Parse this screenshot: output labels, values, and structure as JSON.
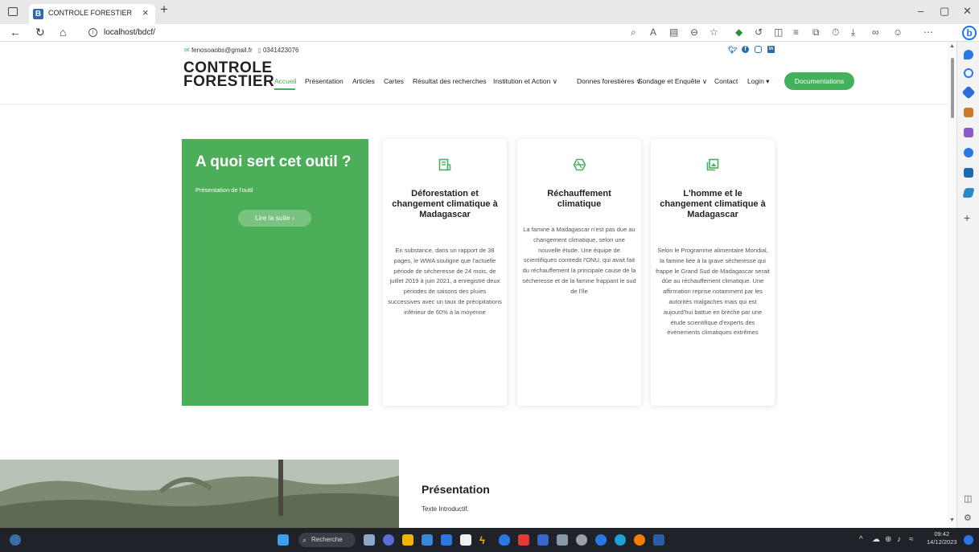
{
  "browser": {
    "tab_title": "CONTROLE FORESTIER",
    "tab_favicon": "B",
    "url": "localhost/bdcf/",
    "window_controls": [
      "–",
      "▢",
      "✕"
    ],
    "new_tab": "+",
    "tab_close": "×"
  },
  "topbar": {
    "email": "fenosoaobs@gmail.fr",
    "phone": "0341423076",
    "social_icons": [
      "twitter-icon",
      "facebook-icon",
      "instagram-icon",
      "linkedin-icon"
    ]
  },
  "header": {
    "logo_line1": "CONTROLE",
    "logo_line2": "FORESTIER",
    "nav": {
      "accueil": "Accueil",
      "presentation": "Présentation",
      "articles": "Articles",
      "cartes": "Cartes",
      "resultat": "Résultat des recherches",
      "institution": "Institution et Action ∨",
      "donnees": "Donnes forestières ∨",
      "sondage": "Sondage et Enquête ∨",
      "contact": "Contact",
      "login": "Login ▾"
    },
    "doc_button": "Documentations"
  },
  "hero": {
    "title": "A quoi sert cet outil ?",
    "subtitle": "Présentation de l'outil",
    "button": "Lire la suite  ›"
  },
  "cards": [
    {
      "icon": "document-chart-icon",
      "title": "Déforestation et changement climatique à Madagascar",
      "text": "En substance, dans un rapport de 38 pages, le WWA souligne que l'actuelle période de sécheresse de 24 mois, de juillet 2019 à juin 2021, a enregistré deux périodes de saisons des pluies successives avec un taux de précipitations inférieur de 60% à la moyenne"
    },
    {
      "icon": "globe-hexagon-icon",
      "title": "Réchauffement climatique",
      "text": "La famine à Madagascar n'est pas due au changement climatique, selon une nouvelle étude. Une équipe de scientifiques contredit l'ONU, qui avait fait du réchauffement la principale cause de la sécheresse et de la famine frappant le sud de l'île"
    },
    {
      "icon": "image-gallery-icon",
      "title": "L'homme et le changement climatique à Madagascar",
      "text": "Selon le Programme alimentaire Mondial, la famine liée à la grave sécheresse qui frappe le Grand Sud de Madagascar serait dûe au réchauffement climatique. Une affirmation reprise notamment par les autorités malgaches mais qui est aujourd'hui battue en brèche par une étude scientifique d'experts des événements climatiques extrêmes"
    }
  ],
  "presentation": {
    "title": "Présentation",
    "text": "Texte Introductif."
  },
  "taskbar": {
    "search": "Recherche",
    "time": "09:42",
    "date": "14/12/2023"
  },
  "colors": {
    "accent_green": "#4cae58",
    "link_blue": "#2b6cb0"
  }
}
